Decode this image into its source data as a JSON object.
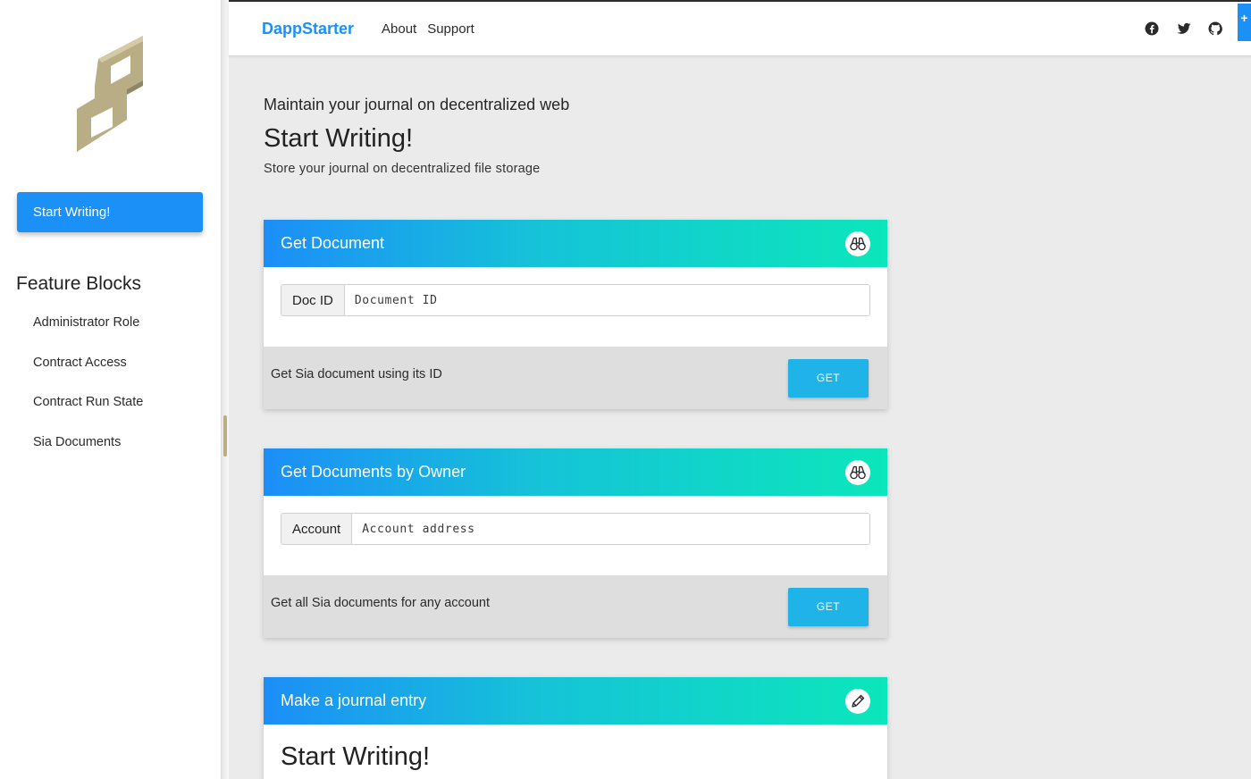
{
  "sidebar": {
    "primary_button": "Start Writing!",
    "feature_heading": "Feature Blocks",
    "items": [
      {
        "label": "Administrator Role"
      },
      {
        "label": "Contract Access"
      },
      {
        "label": "Contract Run State"
      },
      {
        "label": "Sia Documents"
      }
    ]
  },
  "topbar": {
    "brand": "DappStarter",
    "nav": [
      {
        "label": "About"
      },
      {
        "label": "Support"
      }
    ],
    "social_icons": [
      "facebook-icon",
      "twitter-icon",
      "github-icon"
    ],
    "corner_button": "+"
  },
  "main": {
    "subtitle": "Maintain your journal on decentralized web",
    "title": "Start Writing!",
    "description": "Store your journal on decentralized file storage"
  },
  "cards": [
    {
      "title": "Get Document",
      "icon": "binoculars-icon",
      "input_label": "Doc ID",
      "input_placeholder": "Document ID",
      "input_value": "",
      "footer_text": "Get Sia document using its ID",
      "button_label": "GET"
    },
    {
      "title": "Get Documents by Owner",
      "icon": "binoculars-icon",
      "input_label": "Account",
      "input_placeholder": "Account address",
      "input_value": "",
      "footer_text": "Get all Sia documents for any account",
      "button_label": "GET"
    },
    {
      "title": "Make a journal entry",
      "icon": "pencil-icon",
      "body_heading": "Start Writing!"
    }
  ],
  "colors": {
    "brand": "#1b90f7",
    "button": "#1fb3e8",
    "gradient_start": "#1c8ef8",
    "gradient_end": "#0ce6bb",
    "logo": "#b8ad85"
  }
}
